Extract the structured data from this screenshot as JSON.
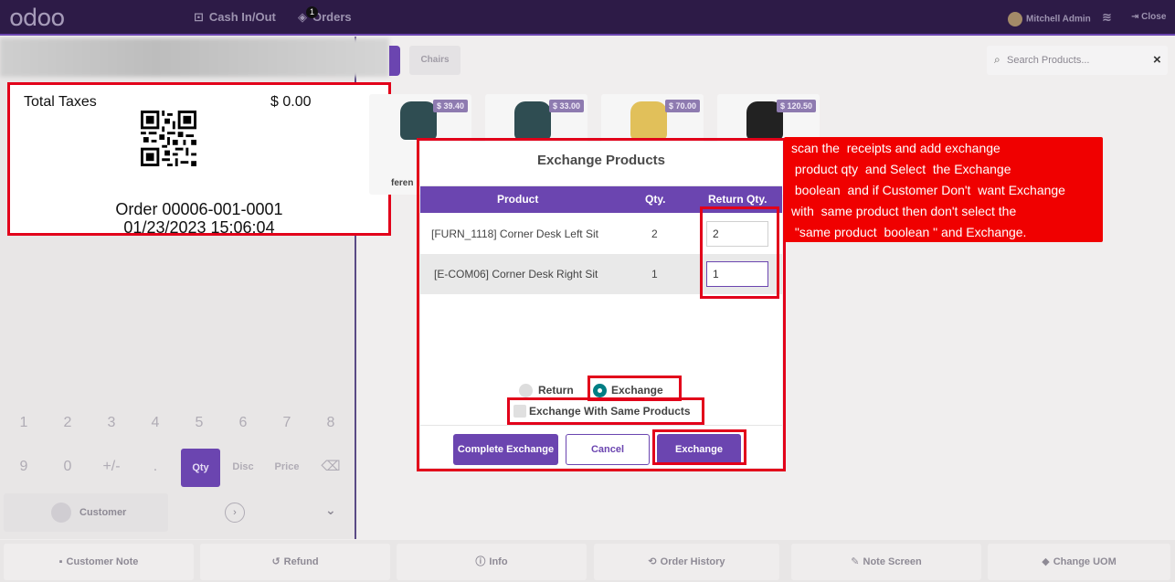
{
  "topbar": {
    "logo": "odoo",
    "cash_in_out": "Cash In/Out",
    "orders": "Orders",
    "orders_badge": "1",
    "user": "Mitchell Admin",
    "close": "Close"
  },
  "receipt": {
    "total_taxes_label": "Total Taxes",
    "total_taxes_value": "$ 0.00",
    "order": "Order 00006-001-0001",
    "datetime": "01/23/2023 15:06:04"
  },
  "numpad": {
    "keys": [
      "1",
      "2",
      "3",
      "4",
      "5",
      "6",
      "7",
      "8",
      "9",
      "0",
      "+/-",
      "."
    ],
    "qty": "Qty",
    "disc": "Disc",
    "price": "Price",
    "customer": "Customer"
  },
  "categories": {
    "chairs": "Chairs"
  },
  "search": {
    "placeholder": "Search Products..."
  },
  "products": {
    "prices": [
      "$ 39.40",
      "$ 33.00",
      "$ 70.00",
      "$ 120.50"
    ],
    "partial_label": "feren"
  },
  "bottombar": {
    "customer_note": "Customer Note",
    "refund": "Refund",
    "info": "Info",
    "order_history": "Order History",
    "note_screen": "Note Screen",
    "change_uom": "Change UOM"
  },
  "dialog": {
    "title": "Exchange Products",
    "columns": {
      "product": "Product",
      "qty": "Qty.",
      "return_qty": "Return Qty."
    },
    "rows": [
      {
        "product": "[FURN_1118] Corner Desk Left Sit",
        "qty": "2",
        "return_qty": "2"
      },
      {
        "product": "[E-COM06] Corner Desk Right Sit",
        "qty": "1",
        "return_qty": "1"
      }
    ],
    "return_label": "Return",
    "exchange_label": "Exchange",
    "same_products_label": "Exchange With Same Products",
    "complete_exchange": "Complete Exchange",
    "cancel": "Cancel",
    "exchange_button": "Exchange"
  },
  "annotation": {
    "lines": [
      "scan the  receipts and add exchange",
      " product qty  and Select  the Exchange",
      " boolean  and if Customer Don't  want Exchange",
      "with  same product then don't select the",
      " \"same product  boolean \" and Exchange."
    ]
  },
  "colors": {
    "brand": "#6b45b0",
    "topbar": "#2d1b47",
    "highlight": "#e2001a",
    "radio_on": "#017e84"
  }
}
